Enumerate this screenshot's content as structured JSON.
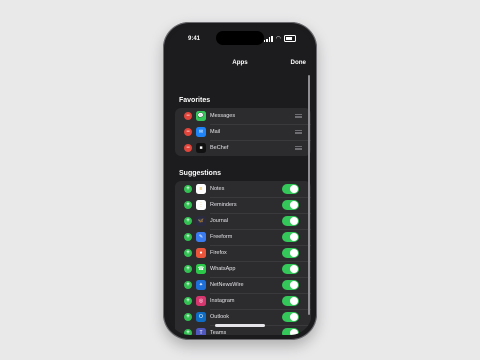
{
  "status_bar": {
    "time": "9:41"
  },
  "nav": {
    "title": "Apps",
    "done_label": "Done"
  },
  "favorites": {
    "header": "Favorites",
    "items": [
      {
        "label": "Messages",
        "icon": "messages-icon",
        "color": "#34c759",
        "glyph": "💬"
      },
      {
        "label": "Mail",
        "icon": "mail-icon",
        "color": "#1e84f7",
        "glyph": "✉"
      },
      {
        "label": "BeChef",
        "icon": "bechef-icon",
        "color": "#111111",
        "glyph": "■"
      }
    ]
  },
  "suggestions": {
    "header": "Suggestions",
    "items": [
      {
        "label": "Notes",
        "icon": "notes-icon",
        "color": "#fdfdfd",
        "glyph": "≡",
        "enabled": true
      },
      {
        "label": "Reminders",
        "icon": "reminders-icon",
        "color": "#fdfdfd",
        "glyph": "⋮",
        "enabled": true
      },
      {
        "label": "Journal",
        "icon": "journal-icon",
        "color": "#2a2a40",
        "glyph": "🦋",
        "enabled": true
      },
      {
        "label": "Freeform",
        "icon": "freeform-icon",
        "color": "#3a7cf0",
        "glyph": "✎",
        "enabled": true
      },
      {
        "label": "Firefox",
        "icon": "firefox-icon",
        "color": "#e8553b",
        "glyph": "●",
        "enabled": true
      },
      {
        "label": "WhatsApp",
        "icon": "whatsapp-icon",
        "color": "#2cc84a",
        "glyph": "☎",
        "enabled": true
      },
      {
        "label": "NetNewsWire",
        "icon": "netnewswire-icon",
        "color": "#1f6fd9",
        "glyph": "✦",
        "enabled": true
      },
      {
        "label": "Instagram",
        "icon": "instagram-icon",
        "color": "#d6366e",
        "glyph": "◎",
        "enabled": true
      },
      {
        "label": "Outlook",
        "icon": "outlook-icon",
        "color": "#0f6cc4",
        "glyph": "O",
        "enabled": true
      },
      {
        "label": "Teams",
        "icon": "teams-icon",
        "color": "#5058c0",
        "glyph": "T",
        "enabled": true
      },
      {
        "label": "",
        "icon": "app-icon",
        "color": "#c13b3b",
        "glyph": "",
        "enabled": true
      }
    ]
  }
}
